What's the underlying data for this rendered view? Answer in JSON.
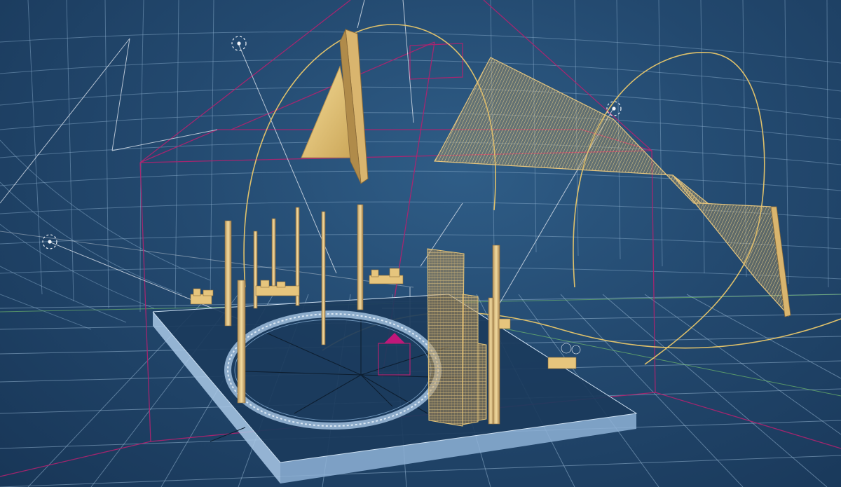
{
  "viewport": {
    "background_color": "#23496f",
    "grid_color": "#8fb2d1",
    "wire_yellow": "#e9c76a",
    "wire_magenta": "#b0226f",
    "solid_gold": "#e9c77b",
    "platform_color": "#1b3b5c",
    "platform_edge_color": "#a9c8e6"
  },
  "scene_objects": [
    "platform",
    "ring-track",
    "columns",
    "panel-wall",
    "small-triangular-sail",
    "large-twisted-sail",
    "lights",
    "cameras",
    "view-frustum"
  ]
}
